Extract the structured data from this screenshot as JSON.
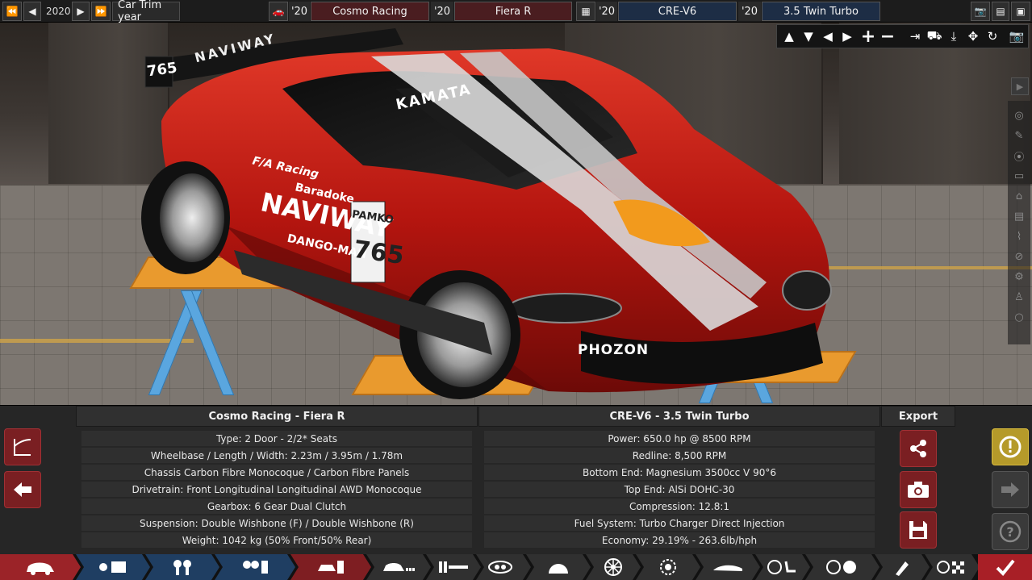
{
  "topbar": {
    "year": "2020",
    "trim_label": "Car Trim year",
    "model_year_1": "'20",
    "model_family": "Cosmo Racing",
    "model_year_2": "'20",
    "trim_name": "Fiera R",
    "engine_year_1": "'20",
    "engine_family": "CRE-V6",
    "engine_year_2": "'20",
    "engine_variant": "3.5 Twin Turbo"
  },
  "scene": {
    "decal_number": "765",
    "decal_sponsor_main": "NAVIWAY",
    "decal_windshield": "KAMATA",
    "decal_front": "PHOZON",
    "decal_side_1": "F/A Racing",
    "decal_side_2": "Baradoke",
    "decal_side_3": "DANGO-MAN",
    "decal_side_4": "PAMKO",
    "decal_wing": "NAVIWAY"
  },
  "car_panel": {
    "title": "Cosmo Racing - Fiera R",
    "rows": [
      "Type: 2 Door - 2/2* Seats",
      "Wheelbase / Length / Width: 2.23m / 3.95m / 1.78m",
      "Chassis Carbon Fibre Monocoque / Carbon Fibre Panels",
      "Drivetrain: Front Longitudinal Longitudinal AWD Monocoque",
      "Gearbox: 6 Gear Dual Clutch",
      "Suspension: Double Wishbone (F) / Double Wishbone (R)",
      "Weight: 1042 kg (50% Front/50% Rear)"
    ]
  },
  "engine_panel": {
    "title": "CRE-V6 - 3.5 Twin Turbo",
    "rows": [
      "Power: 650.0 hp @ 8500 RPM",
      "Redline:  8,500 RPM",
      "Bottom End: Magnesium 3500cc V 90°6",
      "Top End: AlSi DOHC-30",
      "Compression: 12.8:1",
      "Fuel System: Turbo Charger Direct Injection",
      "Economy: 29.19% - 263.6lb/hph"
    ]
  },
  "export": {
    "title": "Export"
  },
  "colors": {
    "accent_red": "#9b2328",
    "accent_blue": "#1f3e62",
    "warning_yellow": "#b59a2a"
  }
}
